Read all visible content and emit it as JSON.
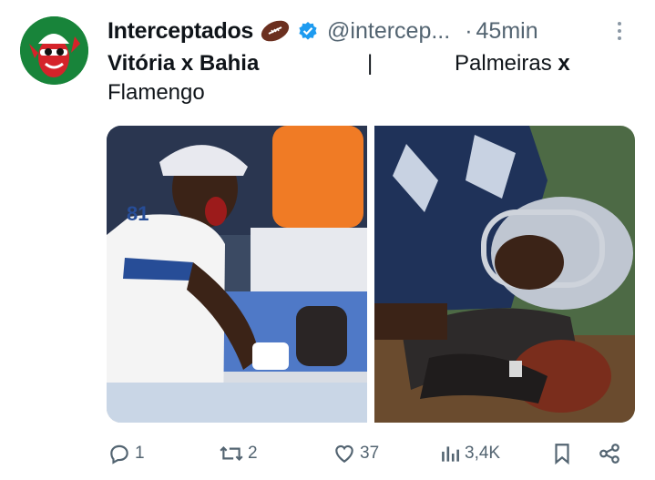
{
  "tweet": {
    "display_name": "Interceptados",
    "handle": "@intercep...",
    "separator": "·",
    "time": "45min",
    "text_line1_a": "Vitória x Bahia",
    "text_line1_b": "|",
    "text_line1_c_prefix": "Palmeiras ",
    "text_line1_c_bold": "x",
    "text_line2": "Flamengo"
  },
  "actions": {
    "replies": "1",
    "retweets": "2",
    "likes": "37",
    "views": "3,4K"
  },
  "colors": {
    "text": "#0f1419",
    "muted": "#536471",
    "verified": "#1d9bf0",
    "avatar_bg": "#18843a"
  },
  "icons": [
    "american-football-emoji",
    "verified-badge-icon",
    "more-icon",
    "reply-icon",
    "retweet-icon",
    "like-icon",
    "views-icon",
    "bookmark-icon",
    "share-icon"
  ]
}
